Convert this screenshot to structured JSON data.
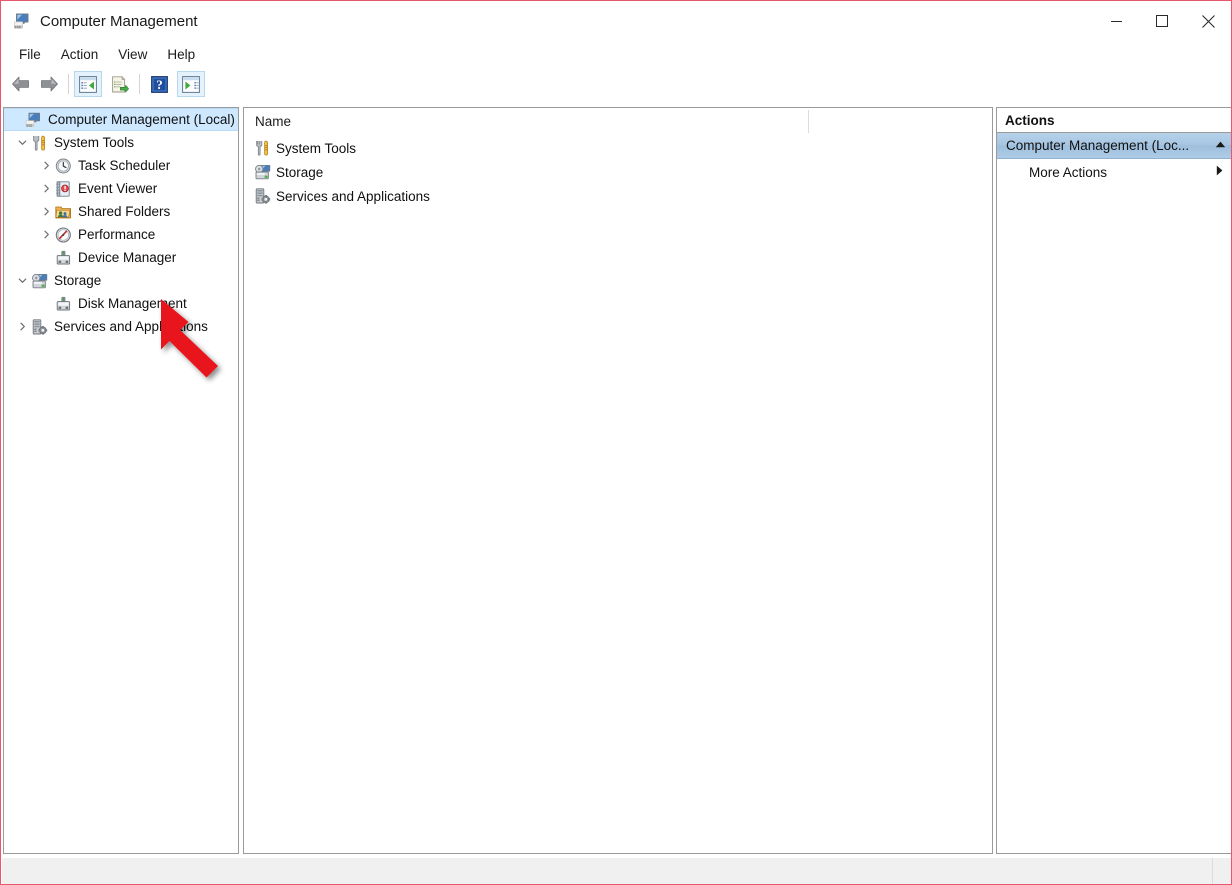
{
  "window": {
    "title": "Computer Management",
    "icon": "computer-management-icon",
    "minimize_label": "Minimize",
    "maximize_label": "Maximize",
    "close_label": "Close"
  },
  "menubar": {
    "items": [
      {
        "label": "File"
      },
      {
        "label": "Action"
      },
      {
        "label": "View"
      },
      {
        "label": "Help"
      }
    ]
  },
  "toolbar": {
    "buttons": [
      {
        "name": "back-button",
        "icon": "back-arrow-icon",
        "framed": false
      },
      {
        "name": "forward-button",
        "icon": "forward-arrow-icon",
        "framed": false
      },
      {
        "name": "show-hide-console-tree-button",
        "icon": "console-tree-icon",
        "framed": true
      },
      {
        "name": "export-list-button",
        "icon": "export-list-icon",
        "framed": false
      },
      {
        "name": "help-button",
        "icon": "help-question-icon",
        "framed": false
      },
      {
        "name": "show-hide-action-pane-button",
        "icon": "action-pane-icon",
        "framed": true
      }
    ]
  },
  "tree": {
    "items": [
      {
        "label": "Computer Management (Local)",
        "icon": "computer-management-icon",
        "indent": 0,
        "expander": "none",
        "selected": true
      },
      {
        "label": "System Tools",
        "icon": "system-tools-icon",
        "indent": 1,
        "expander": "expanded",
        "selected": false
      },
      {
        "label": "Task Scheduler",
        "icon": "task-scheduler-icon",
        "indent": 2,
        "expander": "collapsed",
        "selected": false
      },
      {
        "label": "Event Viewer",
        "icon": "event-viewer-icon",
        "indent": 2,
        "expander": "collapsed",
        "selected": false
      },
      {
        "label": "Shared Folders",
        "icon": "shared-folders-icon",
        "indent": 2,
        "expander": "collapsed",
        "selected": false
      },
      {
        "label": "Performance",
        "icon": "performance-icon",
        "indent": 2,
        "expander": "collapsed",
        "selected": false
      },
      {
        "label": "Device Manager",
        "icon": "device-manager-icon",
        "indent": 2,
        "expander": "none",
        "selected": false
      },
      {
        "label": "Storage",
        "icon": "storage-icon",
        "indent": 1,
        "expander": "expanded",
        "selected": false
      },
      {
        "label": "Disk Management",
        "icon": "disk-management-icon",
        "indent": 2,
        "expander": "none",
        "selected": false
      },
      {
        "label": "Services and Applications",
        "icon": "services-and-applications-icon",
        "indent": 1,
        "expander": "collapsed",
        "selected": false
      }
    ]
  },
  "list": {
    "columns": [
      {
        "label": "Name"
      }
    ],
    "rows": [
      {
        "name": "System Tools",
        "icon": "system-tools-icon"
      },
      {
        "name": "Storage",
        "icon": "storage-icon"
      },
      {
        "name": "Services and Applications",
        "icon": "services-and-applications-icon"
      }
    ]
  },
  "actions": {
    "header": "Actions",
    "group": {
      "label": "Computer Management (Loc...",
      "collapse_icon": "triangle-up-icon"
    },
    "items": [
      {
        "label": "More Actions",
        "submenu_icon": "triangle-right-icon"
      }
    ]
  },
  "statusbar": {
    "text": ""
  },
  "annotation": {
    "type": "red-arrow",
    "points_to": "Disk Management",
    "color": "#e8121a"
  },
  "colors": {
    "selection_blue": "#cde8ff",
    "action_group_blue": "#a7c6e2",
    "window_border_pink": "#e8556d",
    "pane_border": "#9a9a9a",
    "status_bg": "#f0f0f0"
  }
}
